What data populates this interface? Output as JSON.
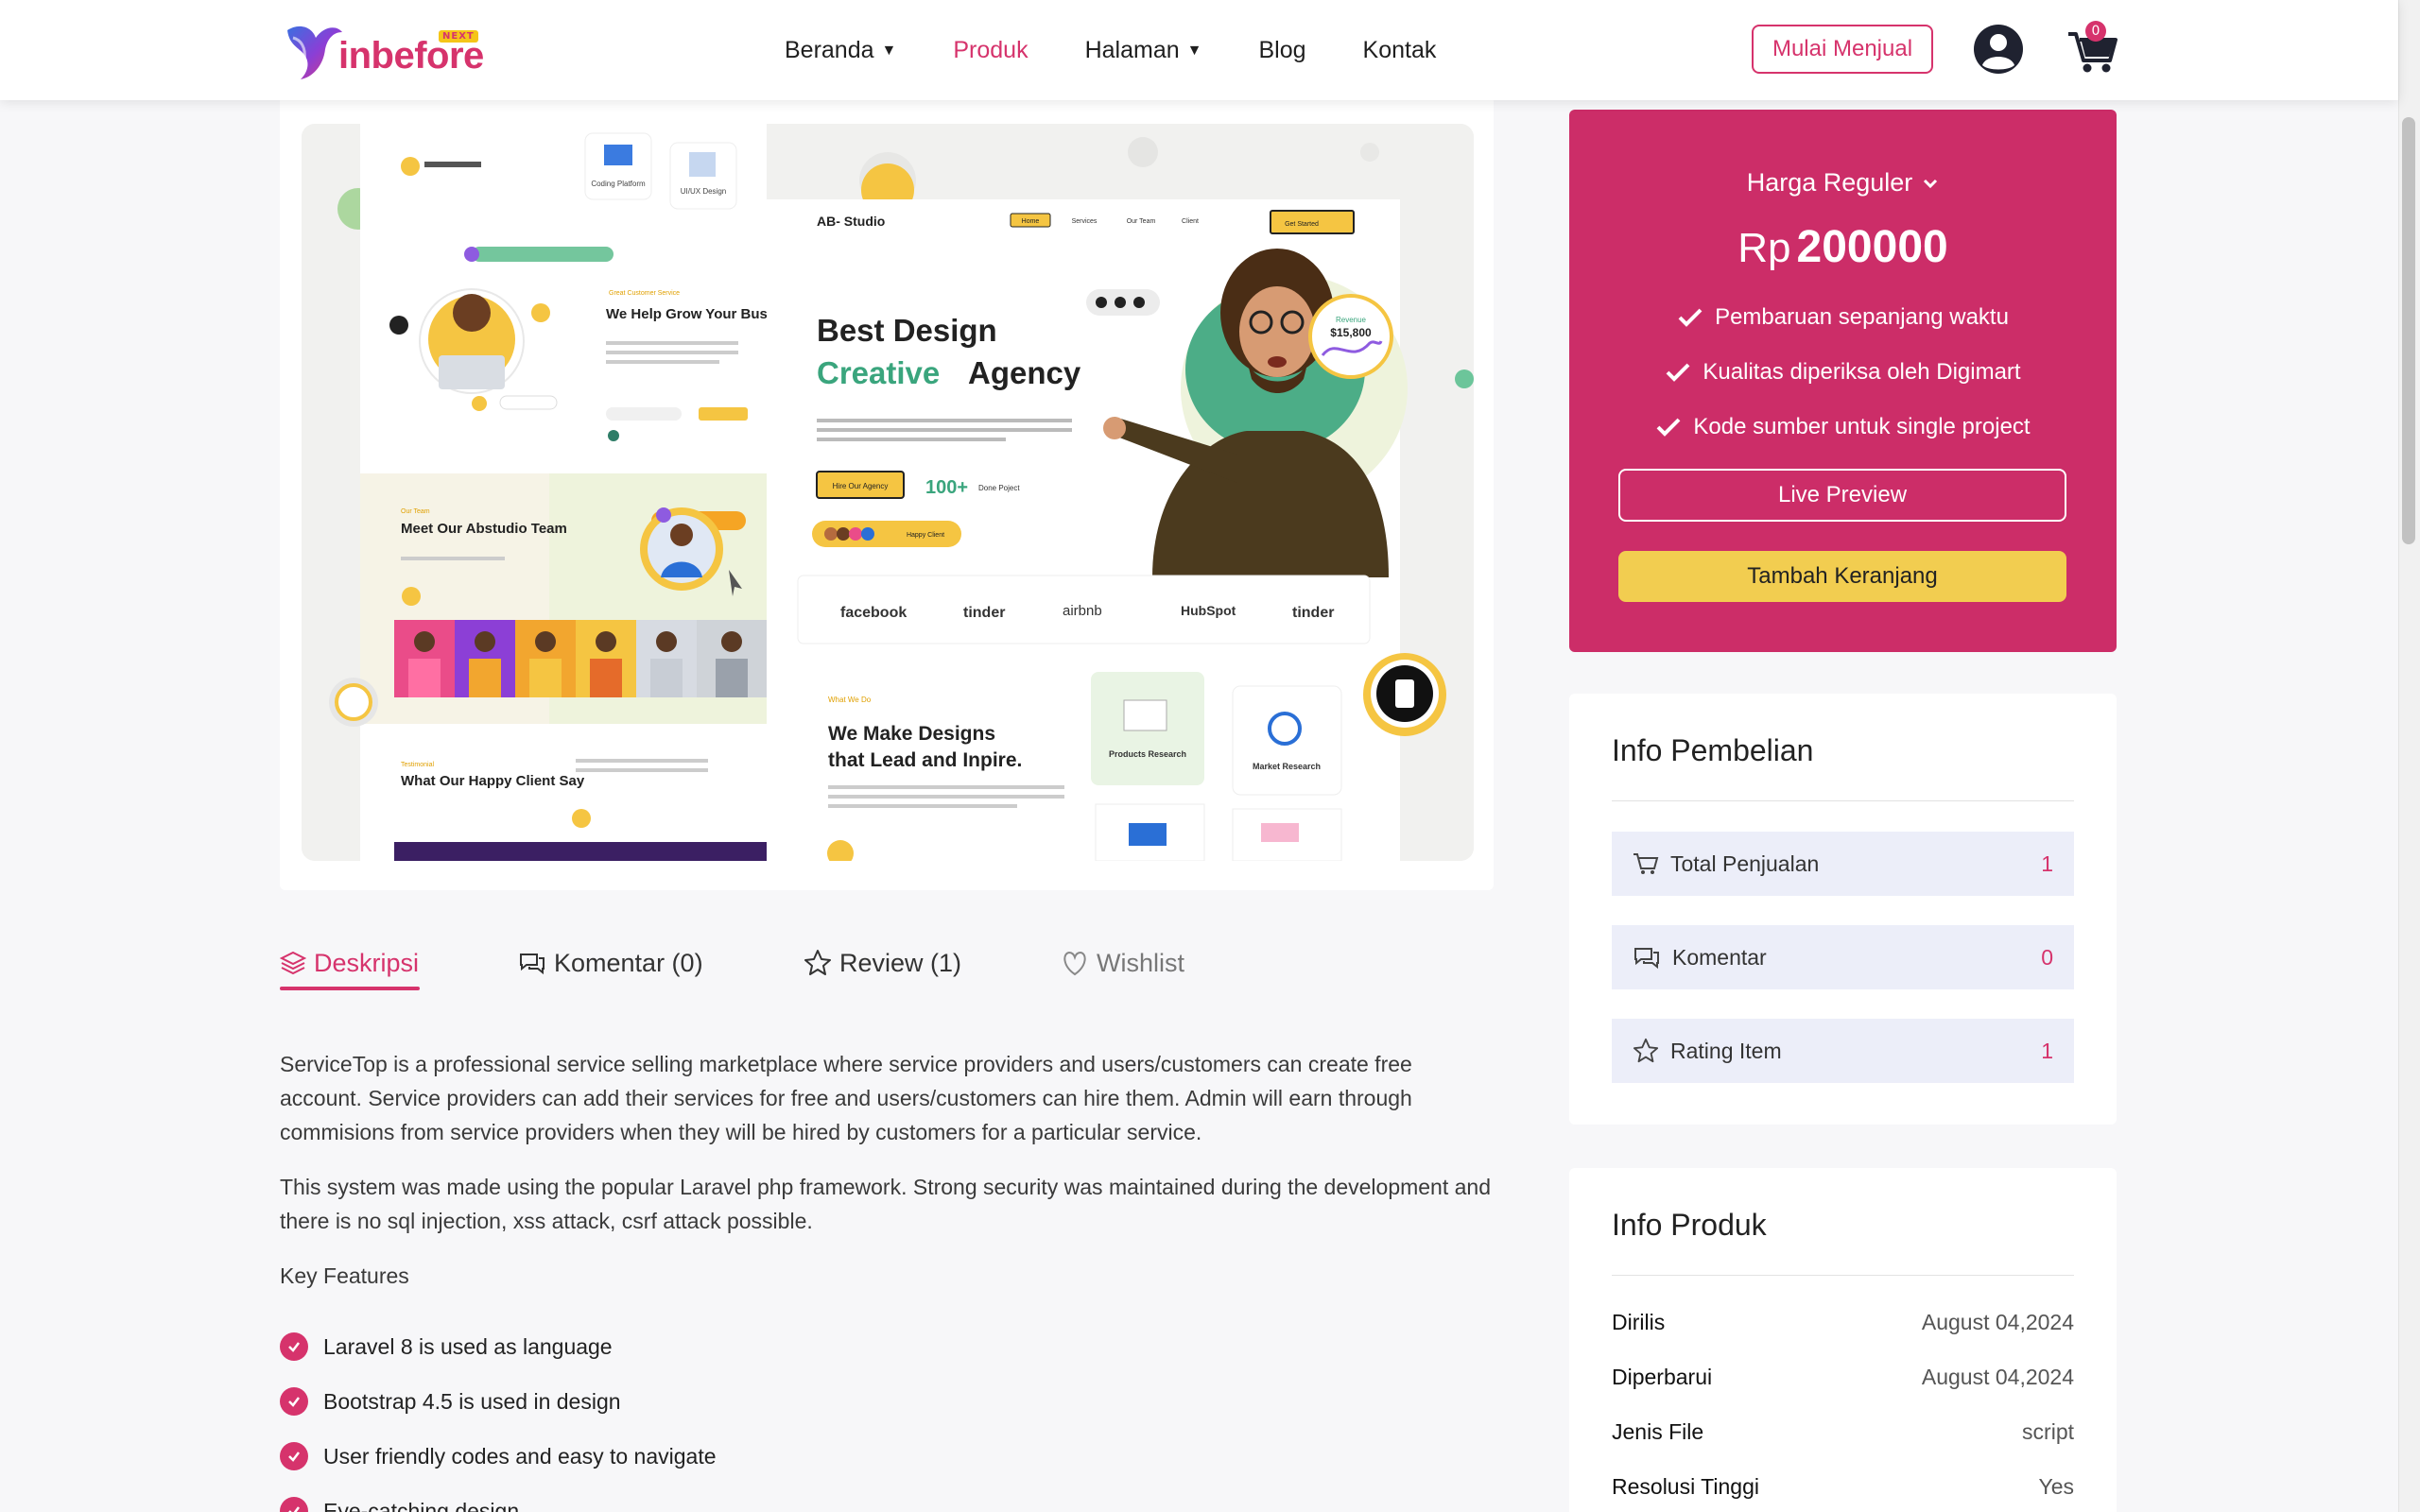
{
  "brand": {
    "name": "inbefore",
    "badge": "NEXT"
  },
  "nav": {
    "items": [
      {
        "label": "Beranda",
        "dropdown": true
      },
      {
        "label": "Produk",
        "active": true
      },
      {
        "label": "Halaman",
        "dropdown": true
      },
      {
        "label": "Blog"
      },
      {
        "label": "Kontak"
      }
    ],
    "sell_button": "Mulai Menjual",
    "cart_count": "0"
  },
  "preview": {
    "left_texts": {
      "grow_title": "We Help Grow Your Business",
      "team_title": "Meet Our Abstudio Team",
      "client_title": "What Our Happy Client Say",
      "coding": "Coding Platform",
      "uiux": "UI/UX Design"
    },
    "mock": {
      "brand": "AB- Studio",
      "nav": [
        "Home",
        "Services",
        "Our Team",
        "Client"
      ],
      "cta": "Get Started",
      "headline_1": "Best Design",
      "headline_2a": "Creative",
      "headline_2b": "Agency",
      "hire": "Hire Our Agency",
      "done_num": "100+",
      "done_lbl": "Done Poject",
      "happy": "Happy Client",
      "revenue_lbl": "Revenue",
      "revenue": "$15,800",
      "logos": [
        "facebook",
        "tinder",
        "airbnb",
        "HubSpot",
        "tinder"
      ],
      "what_we_do": "What We Do",
      "designs_title_1": "We Make Designs",
      "designs_title_2": "that Lead and Inpire.",
      "products_research": "Products Research",
      "market_research": "Market Research"
    }
  },
  "tabs": [
    {
      "label": "Deskripsi",
      "icon": "layers-icon",
      "active": true
    },
    {
      "label": "Komentar (0)",
      "icon": "comments-icon"
    },
    {
      "label": "Review (1)",
      "icon": "star-icon"
    },
    {
      "label": "Wishlist",
      "icon": "heart-icon"
    }
  ],
  "description": {
    "p1": "ServiceTop is a professional service selling marketplace where service providers and users/customers can create free account. Service providers can add their services for free and users/customers can hire them. Admin will earn through commisions from service providers when they will be hired by customers for a particular service.",
    "p2": "This system was made using the popular Laravel php framework. Strong security was maintained during the development and there is no sql injection, xss attack, csrf attack possible.",
    "key_features_label": "Key Features",
    "features": [
      "Laravel 8 is used as language",
      "Bootstrap 4.5 is used in design",
      "User friendly codes and easy to navigate",
      "Eye-catching design"
    ]
  },
  "price_card": {
    "type": "Harga Reguler",
    "currency": "Rp",
    "amount": "200000",
    "features": [
      "Pembaruan sepanjang waktu",
      "Kualitas diperiksa oleh Digimart",
      "Kode sumber untuk single project"
    ],
    "live_preview": "Live Preview",
    "add_to_cart": "Tambah Keranjang"
  },
  "purchase_info": {
    "title": "Info Pembelian",
    "stats": [
      {
        "label": "Total Penjualan",
        "value": "1",
        "icon": "cart-icon"
      },
      {
        "label": "Komentar",
        "value": "0",
        "icon": "comments-icon"
      },
      {
        "label": "Rating Item",
        "value": "1",
        "icon": "star-icon"
      }
    ]
  },
  "product_info": {
    "title": "Info Produk",
    "rows": [
      {
        "key": "Dirilis",
        "value": "August 04,2024"
      },
      {
        "key": "Diperbarui",
        "value": "August 04,2024"
      },
      {
        "key": "Jenis File",
        "value": "script"
      },
      {
        "key": "Resolusi Tinggi",
        "value": "Yes"
      }
    ]
  },
  "colors": {
    "accent": "#cc2d68",
    "accent_text": "#d6336c",
    "yellow": "#f2cd50",
    "stat_bg": "#eceef9"
  }
}
